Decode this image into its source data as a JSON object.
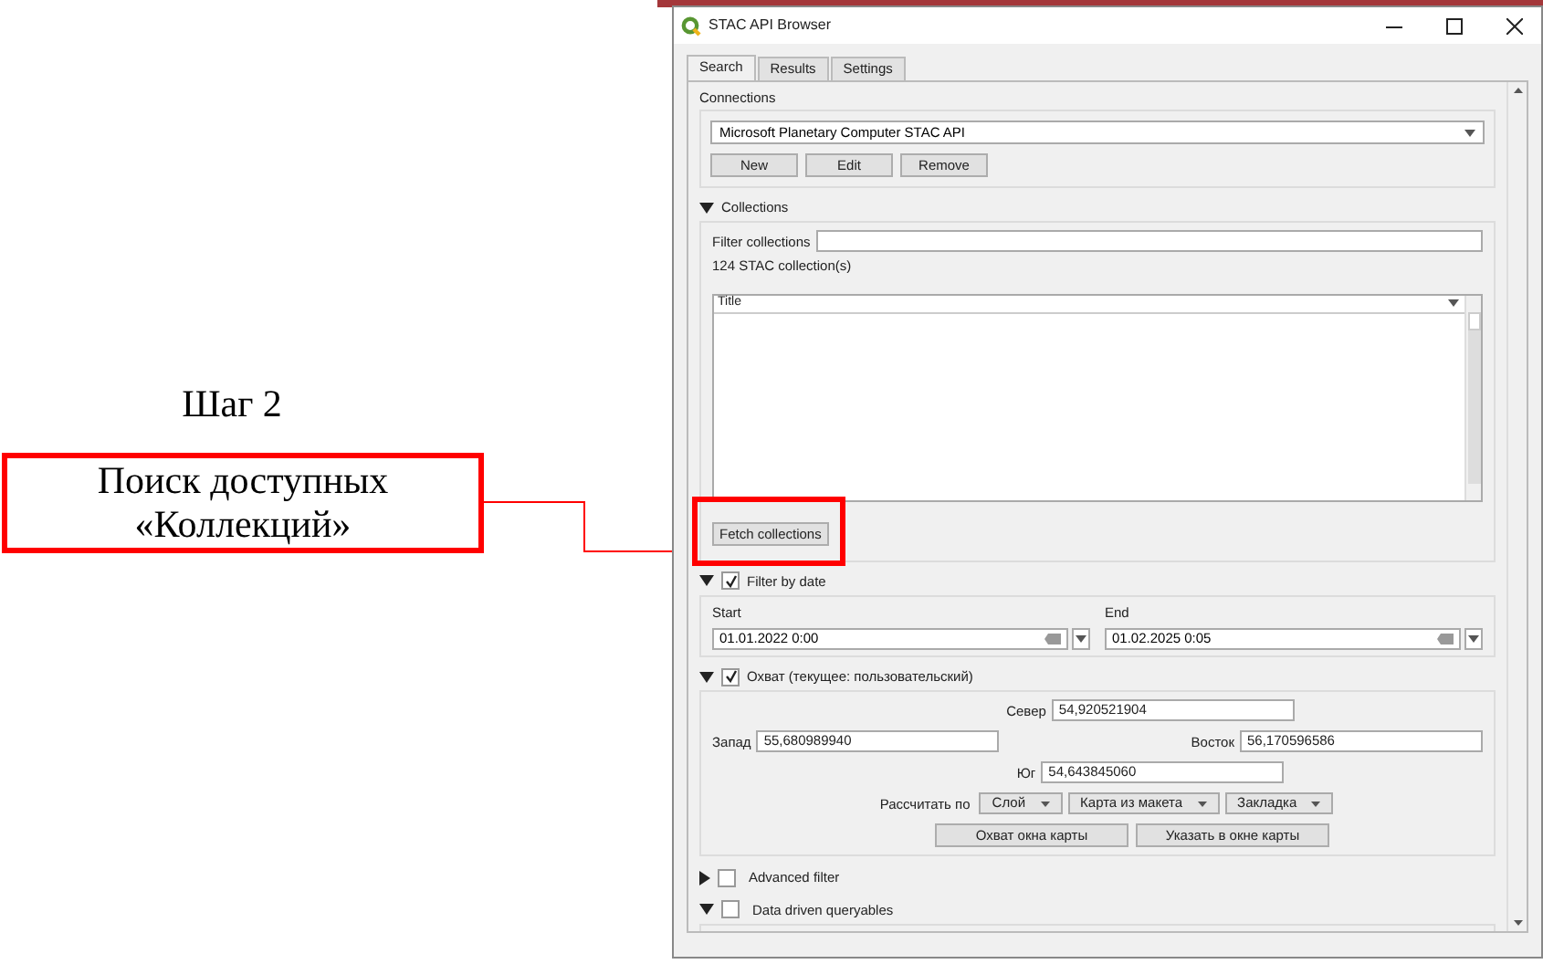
{
  "window": {
    "title": "STAC API Browser"
  },
  "tabs": [
    {
      "label": "Search",
      "selected": true
    },
    {
      "label": "Results",
      "selected": false
    },
    {
      "label": "Settings",
      "selected": false
    }
  ],
  "connections": {
    "label": "Connections",
    "value": "Microsoft Planetary Computer STAC API",
    "buttons": [
      "New",
      "Edit",
      "Remove"
    ]
  },
  "collections": {
    "label": "Collections",
    "expanded": true,
    "filter_label": "Filter collections",
    "count": "124 STAC collection(s)",
    "columns": [
      "Title"
    ],
    "fetch_button": "Fetch collections"
  },
  "filter_by_date": {
    "label": "Filter by date",
    "checked": true,
    "expanded": true,
    "start_label": "Start",
    "start_value": "01.01.2022 0:00",
    "end_label": "End",
    "end_value": "01.02.2025 0:05"
  },
  "extent": {
    "label": "Охват (текущее: пользовательский)",
    "checked": true,
    "expanded": true,
    "north": {
      "label": "Север",
      "value": "54,920521904"
    },
    "west": {
      "label": "Запад",
      "value": "55,680989940"
    },
    "east": {
      "label": "Восток",
      "value": "56,170596586"
    },
    "south": {
      "label": "Юг",
      "value": "54,643845060"
    },
    "calc_label": "Рассчитать по",
    "dropdowns": [
      "Слой",
      "Карта из макета",
      "Закладка"
    ],
    "buttons": [
      "Охват окна карты",
      "Указать в окне карты"
    ]
  },
  "sections": [
    {
      "label": "Advanced filter",
      "checked": false,
      "expanded": false
    },
    {
      "label": "Data driven queryables",
      "checked": false,
      "expanded": true
    }
  ],
  "annotation": {
    "step": "Шаг 2",
    "callout": "Поиск доступных «Коллекций»"
  }
}
